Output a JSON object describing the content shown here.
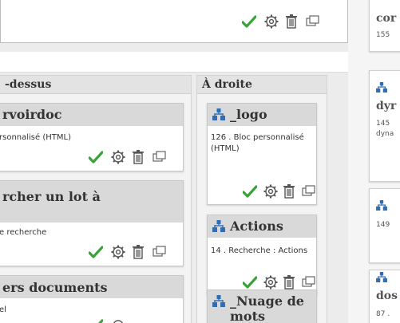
{
  "columns": {
    "middle": {
      "header": "-dessus"
    },
    "right": {
      "header": "À droite"
    }
  },
  "middle_blocks": [
    {
      "title": "rvoirdoc",
      "desc": "rsonnalisé (HTML)"
    },
    {
      "title": "rcher un lot à",
      "desc": "e recherche"
    },
    {
      "title": "ers documents",
      "desc": "el"
    }
  ],
  "right_blocks": [
    {
      "title": "_logo",
      "desc": "126 . Bloc personnalisé (HTML)"
    },
    {
      "title": "Actions",
      "desc": "14 . Recherche : Actions"
    },
    {
      "title": "_Nuage de\nmots",
      "desc": ""
    }
  ],
  "side_cards": [
    {
      "title": "cor",
      "lines": [
        "155"
      ]
    },
    {
      "title": "dyr",
      "lines": [
        "145",
        "dyna"
      ]
    },
    {
      "title": "",
      "lines": [
        "149"
      ]
    },
    {
      "title": "dos",
      "lines": [
        "87 ."
      ]
    }
  ],
  "icons": {
    "enable": "checkmark-icon",
    "settings": "gear-icon",
    "delete": "trash-icon",
    "copy": "duplicate-icon",
    "block": "sitemap-icon"
  },
  "colors": {
    "accent_green": "#3aa23a",
    "icon_blue": "#2f6db5"
  }
}
